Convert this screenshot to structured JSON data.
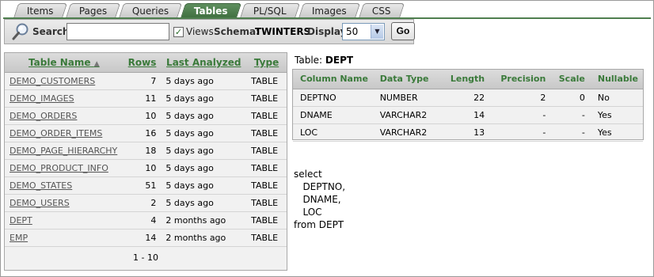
{
  "tabs": [
    {
      "label": "Items"
    },
    {
      "label": "Pages"
    },
    {
      "label": "Queries"
    },
    {
      "label": "Tables"
    },
    {
      "label": "PL/SQL"
    },
    {
      "label": "Images"
    },
    {
      "label": "CSS"
    }
  ],
  "toolbar": {
    "search_label": "Search",
    "search_value": "",
    "views_label": "Views",
    "views_checked": true,
    "schema_label": "Schema:",
    "schema_value": "TWINTERS",
    "display_label": "Display",
    "display_value": "50",
    "go_label": "Go"
  },
  "tables_list": {
    "headers": {
      "name": "Table Name",
      "sort_indicator": "▲",
      "rows": "Rows",
      "analyzed": "Last Analyzed",
      "type": "Type"
    },
    "rows": [
      {
        "name": "DEMO_CUSTOMERS",
        "rows": "7",
        "analyzed": "5 days ago",
        "type": "TABLE"
      },
      {
        "name": "DEMO_IMAGES",
        "rows": "11",
        "analyzed": "5 days ago",
        "type": "TABLE"
      },
      {
        "name": "DEMO_ORDERS",
        "rows": "10",
        "analyzed": "5 days ago",
        "type": "TABLE"
      },
      {
        "name": "DEMO_ORDER_ITEMS",
        "rows": "16",
        "analyzed": "5 days ago",
        "type": "TABLE"
      },
      {
        "name": "DEMO_PAGE_HIERARCHY",
        "rows": "18",
        "analyzed": "5 days ago",
        "type": "TABLE"
      },
      {
        "name": "DEMO_PRODUCT_INFO",
        "rows": "10",
        "analyzed": "5 days ago",
        "type": "TABLE"
      },
      {
        "name": "DEMO_STATES",
        "rows": "51",
        "analyzed": "5 days ago",
        "type": "TABLE"
      },
      {
        "name": "DEMO_USERS",
        "rows": "2",
        "analyzed": "5 days ago",
        "type": "TABLE"
      },
      {
        "name": "DEPT",
        "rows": "4",
        "analyzed": "2 months ago",
        "type": "TABLE"
      },
      {
        "name": "EMP",
        "rows": "14",
        "analyzed": "2 months ago",
        "type": "TABLE"
      }
    ],
    "pager": "1 - 10"
  },
  "detail": {
    "label": "Table:",
    "table_name": "DEPT",
    "headers": {
      "column_name": "Column Name",
      "data_type": "Data Type",
      "length": "Length",
      "precision": "Precision",
      "scale": "Scale",
      "nullable": "Nullable"
    },
    "rows": [
      {
        "column_name": "DEPTNO",
        "data_type": "NUMBER",
        "length": "22",
        "precision": "2",
        "scale": "0",
        "nullable": "No"
      },
      {
        "column_name": "DNAME",
        "data_type": "VARCHAR2",
        "length": "14",
        "precision": "-",
        "scale": "-",
        "nullable": "Yes"
      },
      {
        "column_name": "LOC",
        "data_type": "VARCHAR2",
        "length": "13",
        "precision": "-",
        "scale": "-",
        "nullable": "Yes"
      }
    ]
  },
  "sql_lines": [
    "select",
    "   DEPTNO,",
    "   DNAME,",
    "   LOC",
    "from DEPT"
  ],
  "colors": {
    "accent_green": "#4f7f4f",
    "header_text": "#3a7a3a",
    "panel_bg": "#f1f1f1"
  }
}
